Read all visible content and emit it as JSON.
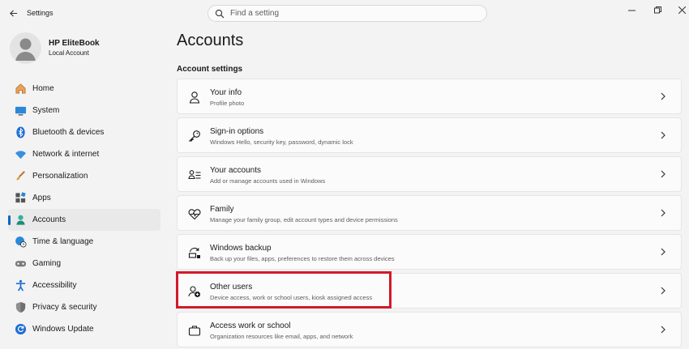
{
  "window": {
    "title": "Settings",
    "controls": [
      "minimize",
      "maximize",
      "close"
    ]
  },
  "search": {
    "placeholder": "Find a setting"
  },
  "profile": {
    "name": "HP EliteBook",
    "account_type": "Local Account"
  },
  "sidebar": {
    "items": [
      {
        "label": "Home",
        "icon": "home-icon"
      },
      {
        "label": "System",
        "icon": "system-icon"
      },
      {
        "label": "Bluetooth & devices",
        "icon": "bluetooth-icon"
      },
      {
        "label": "Network & internet",
        "icon": "wifi-icon"
      },
      {
        "label": "Personalization",
        "icon": "brush-icon"
      },
      {
        "label": "Apps",
        "icon": "apps-icon"
      },
      {
        "label": "Accounts",
        "icon": "accounts-icon",
        "active": true
      },
      {
        "label": "Time & language",
        "icon": "globe-clock-icon"
      },
      {
        "label": "Gaming",
        "icon": "gamepad-icon"
      },
      {
        "label": "Accessibility",
        "icon": "accessibility-icon"
      },
      {
        "label": "Privacy & security",
        "icon": "shield-icon"
      },
      {
        "label": "Windows Update",
        "icon": "update-icon"
      }
    ]
  },
  "main": {
    "title": "Accounts",
    "section_title": "Account settings",
    "cards": [
      {
        "title": "Your info",
        "description": "Profile photo",
        "icon": "person-icon"
      },
      {
        "title": "Sign-in options",
        "description": "Windows Hello, security key, password, dynamic lock",
        "icon": "key-icon"
      },
      {
        "title": "Your accounts",
        "description": "Add or manage accounts used in Windows",
        "icon": "accounts-list-icon"
      },
      {
        "title": "Family",
        "description": "Manage your family group, edit account types and device permissions",
        "icon": "family-heart-icon"
      },
      {
        "title": "Windows backup",
        "description": "Back up your files, apps, preferences to restore them across devices",
        "icon": "backup-icon"
      },
      {
        "title": "Other users",
        "description": "Device access, work or school users, kiosk assigned access",
        "icon": "other-users-icon",
        "highlighted": true
      },
      {
        "title": "Access work or school",
        "description": "Organization resources like email, apps, and network",
        "icon": "briefcase-icon"
      }
    ]
  },
  "colors": {
    "accent": "#0067c0",
    "highlight_border": "#d11a2a",
    "background": "#f3f3f3",
    "card": "#fbfbfb"
  }
}
